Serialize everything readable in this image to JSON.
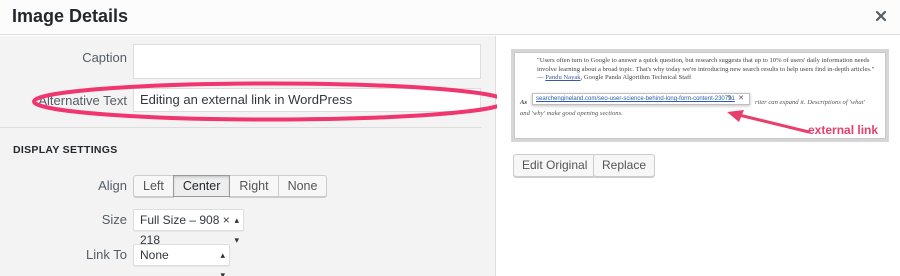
{
  "header": {
    "title": "Image Details",
    "close_icon": "close-icon"
  },
  "form": {
    "caption_label": "Caption",
    "caption_value": "",
    "alt_label": "Alternative Text",
    "alt_value": "Editing an external link in WordPress",
    "display_settings_title": "DISPLAY SETTINGS",
    "align_label": "Align",
    "align_options": [
      "Left",
      "Center",
      "Right",
      "None"
    ],
    "align_selected": "Center",
    "size_label": "Size",
    "size_value": "Full Size – 908 × 218",
    "link_label": "Link To",
    "link_value": "None"
  },
  "preview": {
    "quote_text": "\"Users often turn to Google to answer a quick question, but research suggests that up to 10% of users' daily information needs involve learning about a broad topic. That's why today we're introducing new search results to help users find in-depth articles.\" —",
    "quote_author": "Pandu Nayak",
    "quote_author_suffix": ", Google Panda Algorithm Technical Staff",
    "bold_prefix": "As",
    "link_url": "searchengineland.com/seo-user-science-behind-long-form-content-230721",
    "body_right": "riter can expand it. Descriptions of 'what'",
    "body_line2": "and 'why' make good opening sections.",
    "annotation": "external link",
    "annotation_color": "#e83e6c",
    "edit_original_label": "Edit Original",
    "replace_label": "Replace"
  },
  "colors": {
    "highlight": "#f0356f",
    "link": "#2a5db0"
  }
}
